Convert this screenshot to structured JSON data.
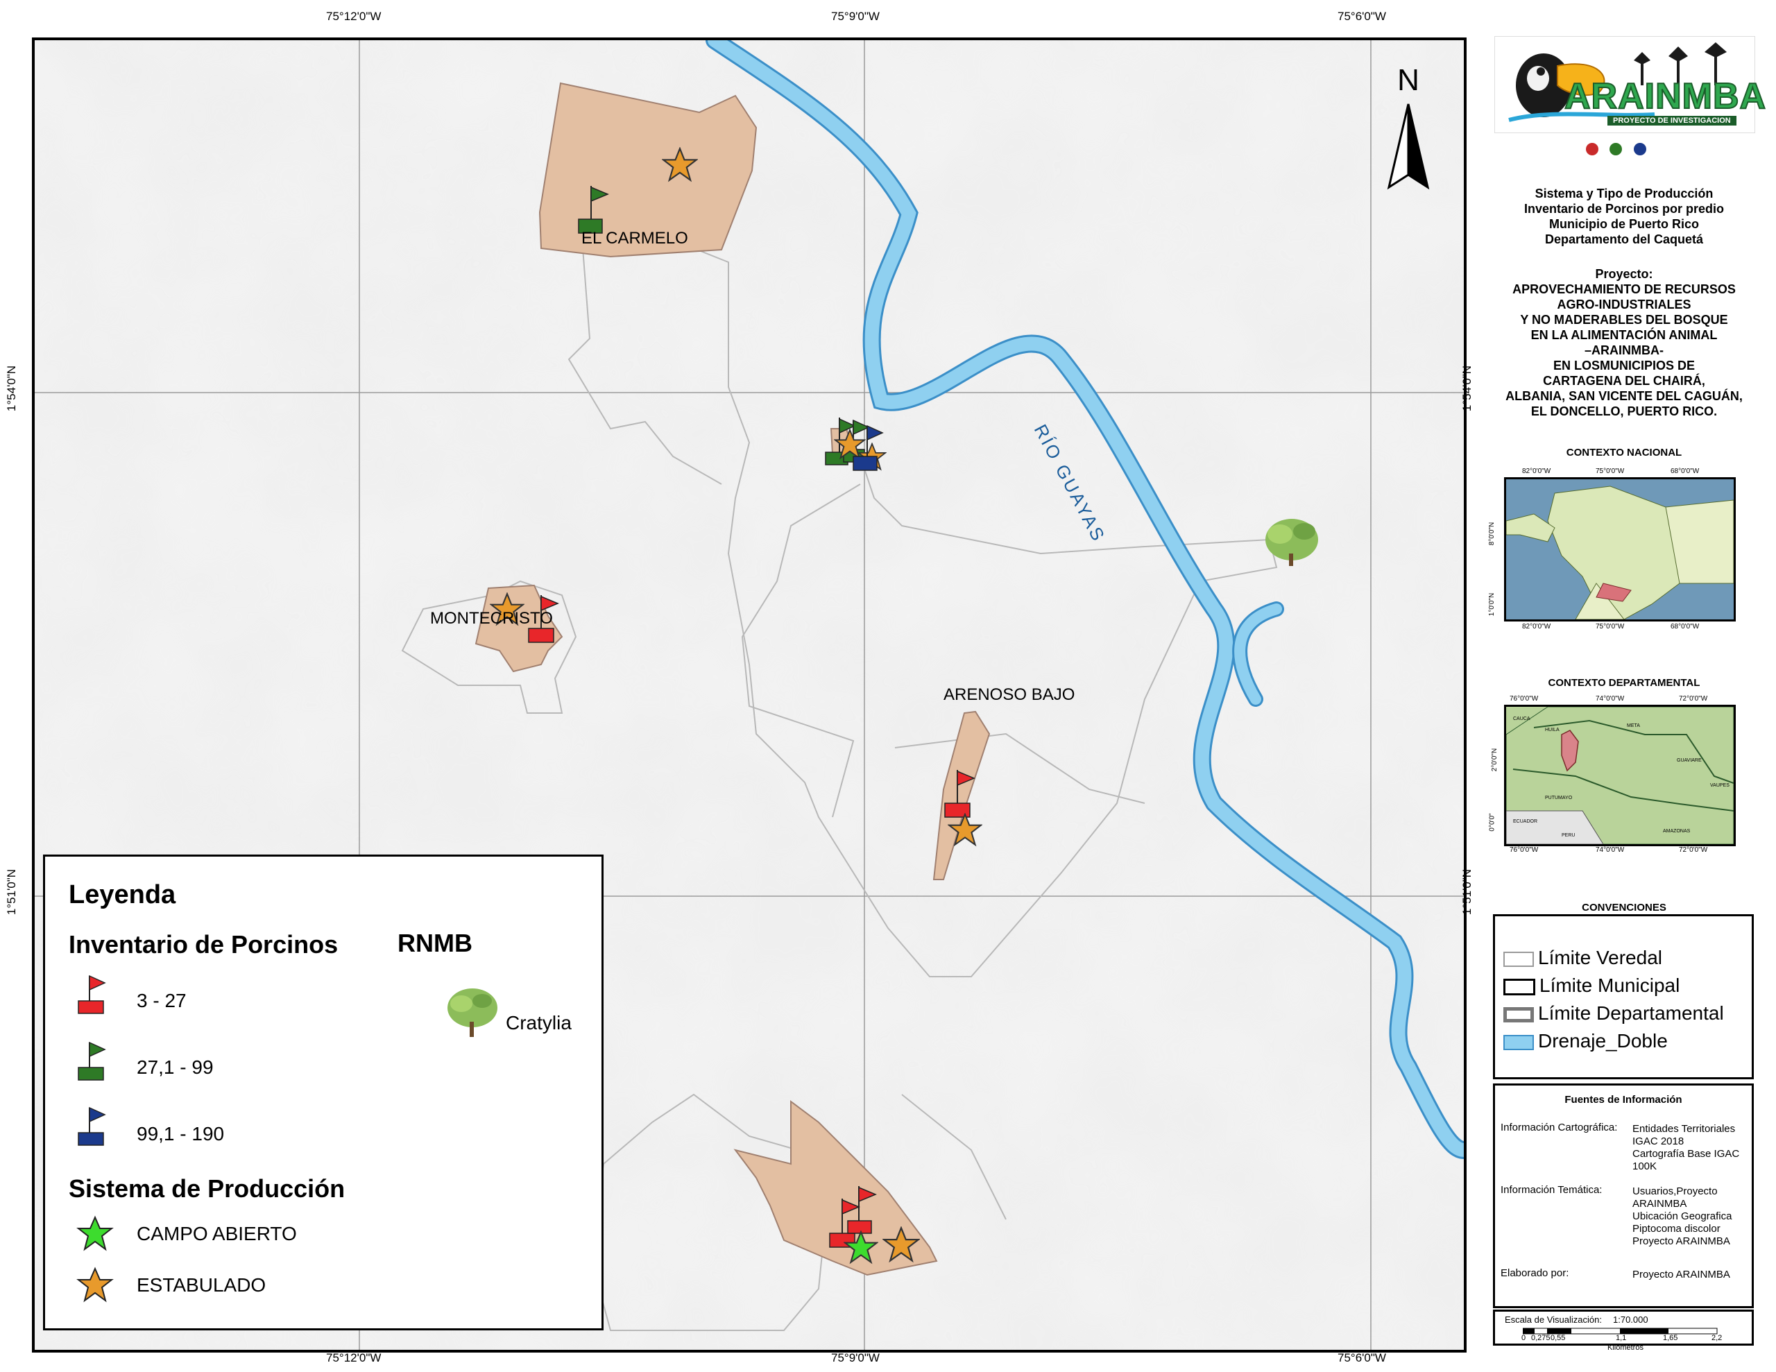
{
  "map": {
    "top_coords": [
      "75°12'0\"W",
      "75°9'0\"W",
      "75°6'0\"W"
    ],
    "bottom_coords": [
      "75°12'0\"W",
      "75°9'0\"W",
      "75°6'0\"W"
    ],
    "left_coords": [
      "1°54'0\"N",
      "1°51'0\"N"
    ],
    "right_coords": [
      "1°54'0\"N",
      "1°51'0\"N"
    ],
    "north_label": "N",
    "river_label": "RÍO GUAYAS",
    "veredas": [
      "EL CARMELO",
      "MONTECRISTO",
      "ARENOSO BAJO"
    ]
  },
  "legend": {
    "title": "Leyenda",
    "inventory_title": "Inventario de Porcinos",
    "rnmb_title": "RNMB",
    "rnmb_item": "Cratylia",
    "inventory_items": [
      {
        "label": "3 - 27",
        "color": "#e8262a"
      },
      {
        "label": "27,1 - 99",
        "color": "#2e7a26"
      },
      {
        "label": "99,1 - 190",
        "color": "#1b3a8c"
      }
    ],
    "system_title": "Sistema de Producción",
    "system_items": [
      {
        "label": "CAMPO ABIERTO",
        "color": "#3ddc2e",
        "icon": "star-icon"
      },
      {
        "label": "ESTABULADO",
        "color": "#e89a2c",
        "icon": "star-icon"
      }
    ]
  },
  "panel": {
    "logo_text": "ARAINMBA",
    "logo_sub": "PROYECTO DE INVESTIGACION",
    "title_lines": [
      "Sistema y Tipo de Producción",
      "Inventario de Porcinos por predio",
      "Municipio de Puerto Rico",
      "Departamento del Caquetá"
    ],
    "project_lines": [
      "Proyecto:",
      "APROVECHAMIENTO DE RECURSOS",
      "AGRO-INDUSTRIALES",
      "Y NO MADERABLES DEL BOSQUE",
      "EN LA ALIMENTACIÓN ANIMAL",
      "–ARAINMBA-",
      "EN LOSMUNICIPIOS DE",
      "CARTAGENA DEL CHAIRÁ,",
      "ALBANIA, SAN VICENTE DEL CAGUÁN,",
      "EL DONCELLO, PUERTO RICO."
    ],
    "national_title": "CONTEXTO NACIONAL",
    "national_top": [
      "82°0'0\"W",
      "75°0'0\"W",
      "68°0'0\"W"
    ],
    "national_bottom": [
      "82°0'0\"W",
      "75°0'0\"W",
      "68°0'0\"W"
    ],
    "national_left": [
      "8°0'0\"N",
      "1°0'0\"N"
    ],
    "dept_title": "CONTEXTO DEPARTAMENTAL",
    "dept_top": [
      "76°0'0\"W",
      "74°0'0\"W",
      "72°0'0\"W"
    ],
    "dept_bottom": [
      "76°0'0\"W",
      "74°0'0\"W",
      "72°0'0\"W"
    ],
    "dept_left": [
      "2°0'0\"N",
      "0°0'0\""
    ],
    "dept_places": [
      "CAUCA",
      "HUILA",
      "META",
      "GUAVIARE",
      "VAUPES",
      "PUTUMAYO",
      "AMAZONAS",
      "ECUADOR",
      "PERU"
    ],
    "conventions_title": "CONVENCIONES",
    "conventions": [
      "Límite Veredal",
      "Límite Municipal",
      "Límite Departamental",
      "Drenaje_Doble"
    ],
    "sources_title": "Fuentes de Información",
    "sources": [
      {
        "label": "Información Cartográfica:",
        "lines": [
          "Entidades Territoriales",
          "IGAC 2018",
          "Cartografía Base IGAC",
          "100K"
        ]
      },
      {
        "label": "Información Temática:",
        "lines": [
          "Usuarios,Proyecto",
          "ARAINMBA",
          "Ubicación Geografica",
          "Piptocoma discolor",
          "Proyecto ARAINMBA"
        ]
      },
      {
        "label": "Elaborado por:",
        "lines": [
          "Proyecto ARAINMBA"
        ]
      }
    ],
    "scale_label": "Escala de Visualización:",
    "scale_value": "1:70.000",
    "scale_ticks": [
      "0",
      "0,275",
      "0,55",
      "1,1",
      "1,65",
      "2,2"
    ],
    "scale_unit": "Kilómetros"
  },
  "colors": {
    "river": "#8fd0f0",
    "river_edge": "#3b8fc8",
    "parcel": "#e3bfa2",
    "flag_red": "#e8262a",
    "flag_green": "#2e7a26",
    "flag_blue": "#1b3a8c",
    "star_orange": "#e89a2c",
    "star_green": "#3ddc2e"
  }
}
